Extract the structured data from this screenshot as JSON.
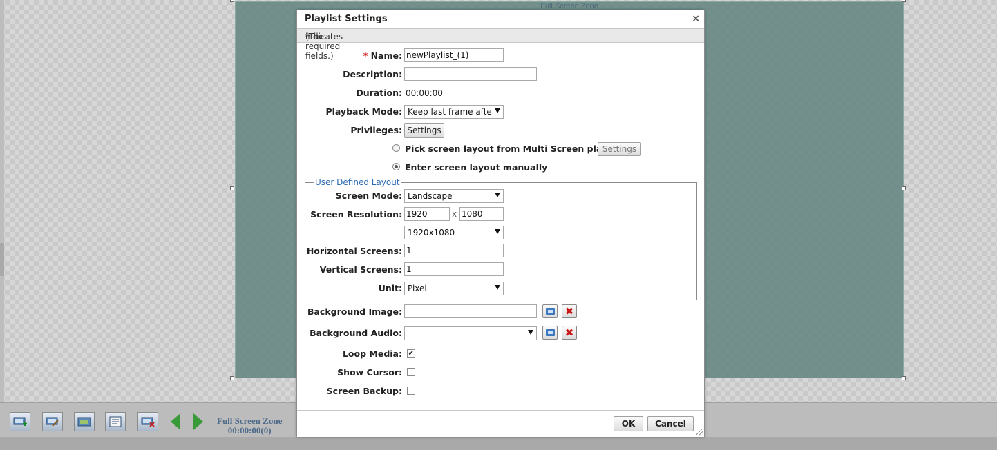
{
  "zone": {
    "title": "Full Screen Zone"
  },
  "toolbar": {
    "zone_name": "Full Screen Zone",
    "zone_duration": "00:00:00(0)",
    "buttons": [
      "add-zone-icon",
      "edit-zone-icon",
      "add-media-icon",
      "zone-properties-icon",
      "delete-zone-icon"
    ]
  },
  "dialog": {
    "title": "Playlist Settings",
    "close": "×",
    "note_prefix": "(The ",
    "note_star": "*",
    "note_suffix": " indicates required fields.)",
    "required_star": "*",
    "fields": {
      "name": {
        "label": "Name:",
        "value": "newPlaylist_(1)"
      },
      "description": {
        "label": "Description:",
        "value": ""
      },
      "duration": {
        "label": "Duration:",
        "value": "00:00:00"
      },
      "playback_mode": {
        "label": "Playback Mode:",
        "value": "Keep last frame afte"
      },
      "privileges": {
        "label": "Privileges:",
        "button": "Settings"
      },
      "layout_option_1": {
        "label": "Pick screen layout from Multi Screen player",
        "button": "Settings",
        "selected": false
      },
      "layout_option_2": {
        "label": "Enter screen layout manually",
        "selected": true
      }
    },
    "user_layout": {
      "legend": "User Defined Layout",
      "screen_mode": {
        "label": "Screen Mode:",
        "value": "Landscape"
      },
      "resolution": {
        "label": "Screen Resolution:",
        "width": "1920",
        "separator": "x",
        "height": "1080",
        "preset": "1920x1080"
      },
      "horizontal": {
        "label": "Horizontal Screens:",
        "value": "1"
      },
      "vertical": {
        "label": "Vertical Screens:",
        "value": "1"
      },
      "unit": {
        "label": "Unit:",
        "value": "Pixel"
      }
    },
    "background_image": {
      "label": "Background Image:",
      "value": ""
    },
    "background_audio": {
      "label": "Background Audio:",
      "value": ""
    },
    "loop_media": {
      "label": "Loop Media:",
      "checked": true
    },
    "show_cursor": {
      "label": "Show Cursor:",
      "checked": false
    },
    "screen_backup": {
      "label": "Screen Backup:",
      "checked": false
    },
    "ok_label": "OK",
    "cancel_label": "Cancel"
  },
  "colors": {
    "accent": "#2d6bb4",
    "required": "#d01010",
    "zone": "#628480"
  }
}
